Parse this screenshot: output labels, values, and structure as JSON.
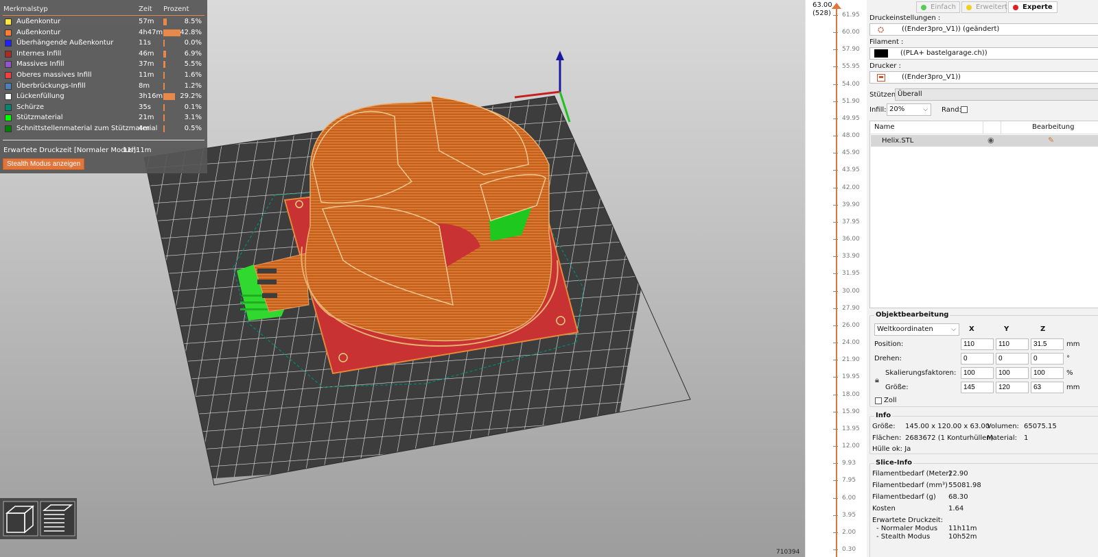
{
  "legend": {
    "headers": {
      "type": "Merkmalstyp",
      "time": "Zeit",
      "percent": "Prozent"
    },
    "rows": [
      {
        "name": "Außenkontur",
        "time": "57m",
        "percent": "8.5%",
        "pct": 8.5,
        "color": "#ffe640"
      },
      {
        "name": "Außenkontur",
        "time": "4h47m",
        "percent": "42.8%",
        "pct": 42.8,
        "color": "#ff7d38"
      },
      {
        "name": "Überhängende Außenkontur",
        "time": "11s",
        "percent": "0.0%",
        "pct": 0.0,
        "color": "#1f1fff"
      },
      {
        "name": "Internes Infill",
        "time": "46m",
        "percent": "6.9%",
        "pct": 6.9,
        "color": "#b02929"
      },
      {
        "name": "Massives Infill",
        "time": "37m",
        "percent": "5.5%",
        "pct": 5.5,
        "color": "#9654cc"
      },
      {
        "name": "Oberes massives Infill",
        "time": "11m",
        "percent": "1.6%",
        "pct": 1.6,
        "color": "#f04040"
      },
      {
        "name": "Überbrückungs-Infill",
        "time": "8m",
        "percent": "1.2%",
        "pct": 1.2,
        "color": "#4d80ba"
      },
      {
        "name": "Lückenfüllung",
        "time": "3h16m",
        "percent": "29.2%",
        "pct": 29.2,
        "color": "#ffffff"
      },
      {
        "name": "Schürze",
        "time": "35s",
        "percent": "0.1%",
        "pct": 0.1,
        "color": "#00876e"
      },
      {
        "name": "Stützmaterial",
        "time": "21m",
        "percent": "3.1%",
        "pct": 3.1,
        "color": "#00ff00"
      },
      {
        "name": "Schnittstellenmaterial zum Stützmaterial",
        "time": "4m",
        "percent": "0.5%",
        "pct": 0.5,
        "color": "#008000"
      }
    ],
    "print_time_label": "Erwartete Druckzeit [Normaler Modus]:",
    "print_time_value": "11h11m",
    "stealth_button": "Stealth Modus anzeigen"
  },
  "viewport": {
    "vertex_count": "710394"
  },
  "layer_slider": {
    "top_value": "63.00",
    "top_layer": "(528)",
    "ticks": [
      "61.95",
      "60.00",
      "57.90",
      "55.95",
      "54.00",
      "51.90",
      "49.95",
      "48.00",
      "45.90",
      "43.95",
      "42.00",
      "39.90",
      "37.95",
      "36.00",
      "33.90",
      "31.95",
      "30.00",
      "27.90",
      "26.00",
      "24.00",
      "21.90",
      "19.95",
      "18.00",
      "15.90",
      "13.95",
      "12.00",
      "9.93",
      "7.95",
      "6.00",
      "3.95",
      "2.00",
      "0.30"
    ]
  },
  "sidebar": {
    "modes": [
      {
        "label": "Einfach",
        "color": "#55cc55",
        "active": false
      },
      {
        "label": "Erweitert",
        "color": "#f0d020",
        "active": false
      },
      {
        "label": "Experte",
        "color": "#dd2222",
        "active": true
      }
    ],
    "print_settings_label": "Druckeinstellungen :",
    "print_settings_value": "((Ender3pro_V1)) (geändert)",
    "filament_label": "Filament :",
    "filament_value": "((PLA+ bastelgarage.ch))",
    "filament_color": "#000000",
    "printer_label": "Drucker :",
    "printer_value": "((Ender3pro_V1))",
    "supports_label": "Stützen:",
    "supports_value": "Überall",
    "infill_label": "Infill:",
    "infill_value": "20%",
    "brim_label": "Rand:",
    "object_list": {
      "col_name": "Name",
      "col_edit": "Bearbeitung",
      "items": [
        {
          "name": "Helix.STL"
        }
      ]
    },
    "object_edit": {
      "title": "Objektbearbeitung",
      "coord_system": "Weltkoordinaten",
      "axis_x": "X",
      "axis_y": "Y",
      "axis_z": "Z",
      "position_label": "Position:",
      "position": [
        "110",
        "110",
        "31.5"
      ],
      "position_unit": "mm",
      "rotate_label": "Drehen:",
      "rotate": [
        "0",
        "0",
        "0"
      ],
      "rotate_unit": "°",
      "scale_label": "Skalierungsfaktoren:",
      "scale": [
        "100",
        "100",
        "100"
      ],
      "scale_unit": "%",
      "size_label": "Größe:",
      "size": [
        "145",
        "120",
        "63"
      ],
      "size_unit": "mm",
      "inch_label": "Zoll"
    },
    "info": {
      "title": "Info",
      "size_label": "Größe:",
      "size_value": "145.00 x 120.00 x 63.00",
      "volume_label": "Volumen:",
      "volume_value": "65075.15",
      "facets_label": "Flächen:",
      "facets_value": "2683672 (1 Konturhüllen)",
      "material_label": "Material:",
      "material_value": "1",
      "manifold": "Hülle ok: Ja"
    },
    "slice_info": {
      "title": "Slice-Info",
      "rows": [
        {
          "label": "Filamentbedarf (Meter)",
          "value": "22.90"
        },
        {
          "label": "Filamentbedarf (mm³)",
          "value": "55081.98"
        },
        {
          "label": "Filamentbedarf (g)",
          "value": "68.30"
        },
        {
          "label": "Kosten",
          "value": "1.64"
        }
      ],
      "time_label": "Erwartete Druckzeit:",
      "normal_label": "- Normaler Modus",
      "normal_value": "11h11m",
      "stealth_label": "- Stealth Modus",
      "stealth_value": "10h52m"
    }
  }
}
